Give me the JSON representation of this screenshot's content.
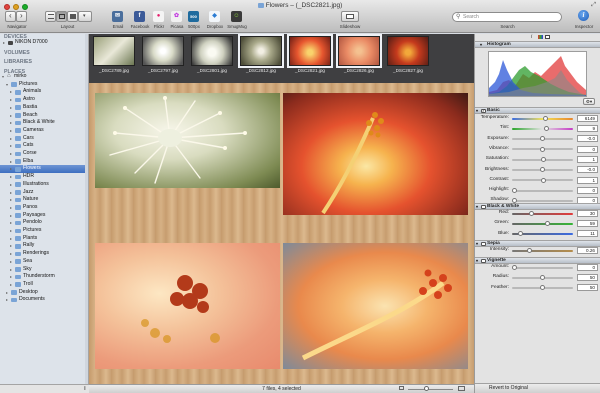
{
  "window": {
    "title": "Flowers – (_DSC2821.jpg)"
  },
  "toolbar": {
    "navigator_label": "Navigator",
    "layout_label": "Layout",
    "services": [
      {
        "label": "Email",
        "icon": "email-icon",
        "color": "#4a6e9c",
        "glyph": "✉"
      },
      {
        "label": "Facebook",
        "icon": "facebook-icon",
        "color": "#3b5a98",
        "glyph": "f"
      },
      {
        "label": "Flickr",
        "icon": "flickr-icon",
        "color": "#f4f4f4",
        "glyph": "●"
      },
      {
        "label": "Picasa",
        "icon": "picasa-icon",
        "color": "#f1f1f1",
        "glyph": "✿"
      },
      {
        "label": "500px",
        "icon": "500px-icon",
        "color": "#1f6b9e",
        "glyph": "500"
      },
      {
        "label": "Dropbox",
        "icon": "dropbox-icon",
        "color": "#f2f6fa",
        "glyph": "◆"
      },
      {
        "label": "SmugMug",
        "icon": "smugmug-icon",
        "color": "#3a3a3a",
        "glyph": "☺"
      }
    ],
    "slideshow_label": "Slideshow",
    "search_placeholder": "Search",
    "search_label": "Search",
    "inspector_label": "Inspector"
  },
  "sidebar": {
    "devices_header": "DEVICES",
    "device": "NIKON D7000",
    "volumes_header": "VOLUMES",
    "libraries_header": "LIBRARIES",
    "places_header": "PLACES",
    "user": "mirko",
    "pictures": "Pictures",
    "folders": [
      "Animals",
      "Astro",
      "Bastia",
      "Beach",
      "Black & White",
      "Cameras",
      "Cars",
      "Cats",
      "Corse",
      "Elba",
      "Flowers",
      "HDR",
      "Illustrations",
      "Jazz",
      "Nature",
      "Panos",
      "Paysages",
      "Pendolo",
      "Pictures",
      "Plants",
      "Rally",
      "Renderings",
      "Sea",
      "Sky",
      "Thunderstorm",
      "Troll"
    ],
    "selected_folder": "Flowers",
    "desktop": "Desktop",
    "documents": "Documents"
  },
  "thumbnails": [
    {
      "name": "_DSC2789.jpg",
      "selected": false
    },
    {
      "name": "_DSC2797.jpg",
      "selected": false
    },
    {
      "name": "_DSC2801.jpg",
      "selected": false
    },
    {
      "name": "_DSC2812.jpg",
      "selected": true
    },
    {
      "name": "_DSC2821.jpg",
      "selected": true
    },
    {
      "name": "_DSC2826.jpg",
      "selected": true
    },
    {
      "name": "_DSC2827.jpg",
      "selected": false
    }
  ],
  "status": {
    "text": "7 files, 4 selected"
  },
  "inspector": {
    "histogram_header": "Histogram",
    "basic_header": "Basic",
    "basic": [
      {
        "label": "Temperature:",
        "value": "6149",
        "pos": 0.55,
        "track": "temp"
      },
      {
        "label": "Tint:",
        "value": "9",
        "pos": 0.57,
        "track": "tint"
      },
      {
        "label": "Exposure:",
        "value": "-0.0",
        "pos": 0.5,
        "track": "gray"
      },
      {
        "label": "Vibrance:",
        "value": "0",
        "pos": 0.5,
        "track": "gray"
      },
      {
        "label": "Saturation:",
        "value": "1",
        "pos": 0.51,
        "track": "gray"
      },
      {
        "label": "Brightness:",
        "value": "-0.0",
        "pos": 0.5,
        "track": "gray"
      },
      {
        "label": "Contrast:",
        "value": "1",
        "pos": 0.51,
        "track": "gray"
      },
      {
        "label": "Highlight:",
        "value": "0",
        "pos": 0.0,
        "track": "gray"
      },
      {
        "label": "Shadow:",
        "value": "0",
        "pos": 0.0,
        "track": "gray"
      }
    ],
    "bw_header": "Black & White",
    "bw": [
      {
        "label": "Red:",
        "value": "30",
        "pos": 0.3,
        "track": "red"
      },
      {
        "label": "Green:",
        "value": "59",
        "pos": 0.59,
        "track": "green"
      },
      {
        "label": "Blue:",
        "value": "11",
        "pos": 0.11,
        "track": "blue"
      }
    ],
    "sepia_header": "Sepia",
    "sepia": [
      {
        "label": "Intensity:",
        "value": "0.26",
        "pos": 0.26,
        "track": "sepia"
      }
    ],
    "vignette_header": "Vignette",
    "vignette": [
      {
        "label": "Amount:",
        "value": "0",
        "pos": 0.0,
        "track": "gray"
      },
      {
        "label": "Radius:",
        "value": "50",
        "pos": 0.5,
        "track": "gray"
      },
      {
        "label": "Feather:",
        "value": "50",
        "pos": 0.5,
        "track": "gray"
      }
    ],
    "revert_label": "Revert to Original"
  }
}
